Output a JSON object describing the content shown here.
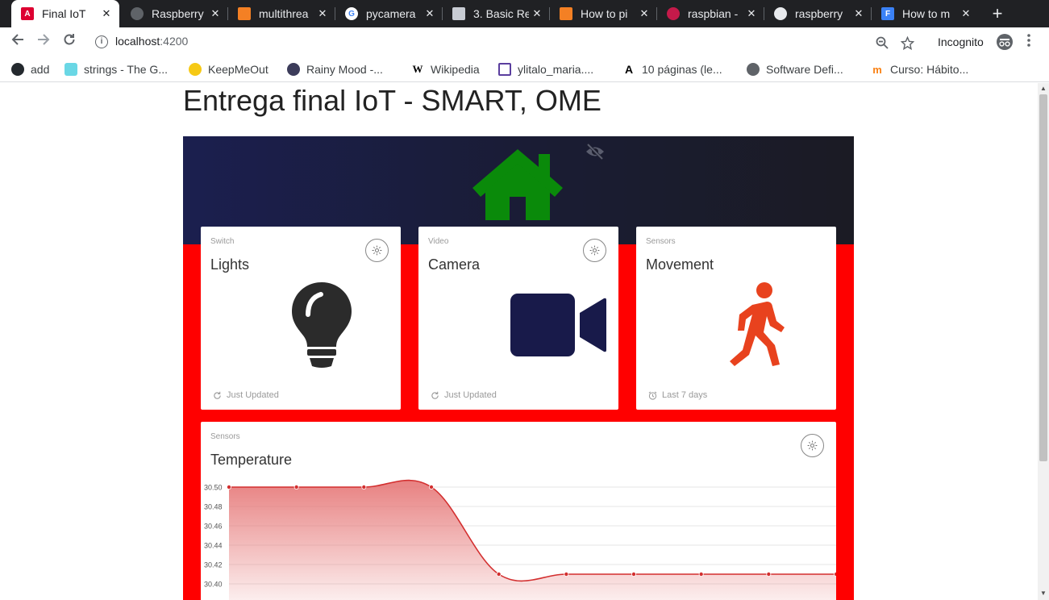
{
  "browser": {
    "tabs": [
      {
        "title": "Final IoT",
        "active": true,
        "icon": "angular-icon"
      },
      {
        "title": "Raspberry",
        "active": false,
        "icon": "globe-icon"
      },
      {
        "title": "multithrea",
        "active": false,
        "icon": "stackoverflow-icon"
      },
      {
        "title": "pycamera",
        "active": false,
        "icon": "google-icon"
      },
      {
        "title": "3. Basic Re",
        "active": false,
        "icon": "docs-icon"
      },
      {
        "title": "How to pi",
        "active": false,
        "icon": "stackoverflow-icon"
      },
      {
        "title": "raspbian -",
        "active": false,
        "icon": "raspberry-icon"
      },
      {
        "title": "raspberry",
        "active": false,
        "icon": "github-icon"
      },
      {
        "title": "How to m",
        "active": false,
        "icon": "f-icon"
      }
    ],
    "url_host": "localhost",
    "url_port": ":4200",
    "incognito_label": "Incognito",
    "bookmarks": [
      {
        "label": "add",
        "icon": "github-icon"
      },
      {
        "label": "strings - The G...",
        "icon": "gopher-icon"
      },
      {
        "label": "KeepMeOut",
        "icon": "smiley-icon"
      },
      {
        "label": "Rainy Mood -...",
        "icon": "raindrop-icon"
      },
      {
        "label": "Wikipedia",
        "icon": "wikipedia-icon"
      },
      {
        "label": "ylitalo_maria....",
        "icon": "spiral-icon"
      },
      {
        "label": "10 páginas (le...",
        "icon": "a-icon"
      },
      {
        "label": "Software Defi...",
        "icon": "globe-icon"
      },
      {
        "label": "Curso: Hábito...",
        "icon": "moodle-icon"
      }
    ]
  },
  "page": {
    "title": "Entrega final IoT - SMART, OME"
  },
  "colors": {
    "dashboard_bg": "#ff0000",
    "header_bg": "#1b1f3a",
    "home_icon": "#0a8a0a",
    "bulb_icon": "#2b2b2b",
    "camera_icon": "#181a4a",
    "walker_icon": "#e8421e",
    "chart_line": "#d32f2f"
  },
  "cards": [
    {
      "category": "Switch",
      "title": "Lights",
      "icon": "lightbulb-icon",
      "footer_icon": "refresh-icon",
      "footer": "Just Updated"
    },
    {
      "category": "Video",
      "title": "Camera",
      "icon": "video-camera-icon",
      "footer_icon": "refresh-icon",
      "footer": "Just Updated"
    },
    {
      "category": "Sensors",
      "title": "Movement",
      "icon": "walking-person-icon",
      "footer_icon": "alarm-clock-icon",
      "footer": "Last 7 days"
    }
  ],
  "temperature": {
    "category": "Sensors",
    "title": "Temperature"
  },
  "chart_data": {
    "type": "line",
    "title": "",
    "xlabel": "",
    "ylabel": "",
    "ylim": [
      30.4,
      30.5
    ],
    "yticks": [
      "30.50",
      "30.48",
      "30.46",
      "30.44",
      "30.42",
      "30.40"
    ],
    "series": [
      {
        "values": [
          30.5,
          30.5,
          30.5,
          30.5,
          30.41,
          30.41,
          30.41,
          30.41,
          30.41,
          30.41
        ]
      }
    ],
    "fill": "area-under-line",
    "grid": true,
    "legend": "none"
  }
}
